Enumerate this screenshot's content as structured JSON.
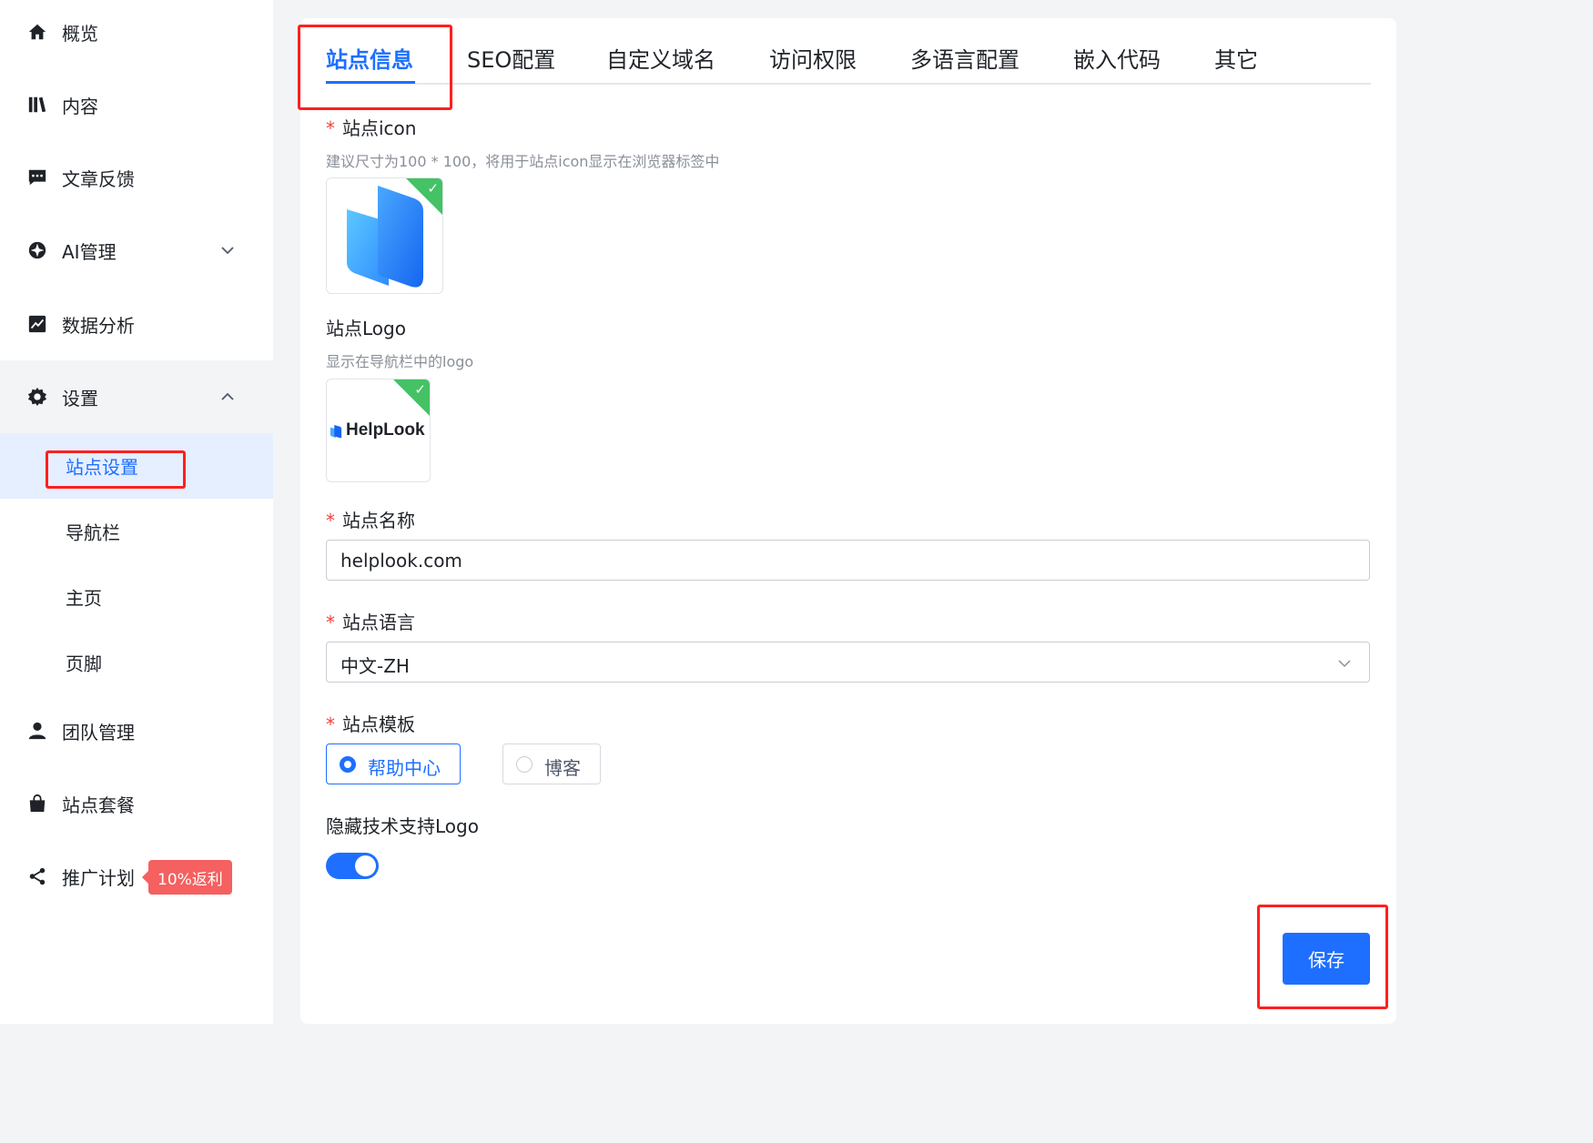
{
  "sidebar": {
    "items": [
      {
        "label": "概览",
        "icon": "home-icon"
      },
      {
        "label": "内容",
        "icon": "books-icon"
      },
      {
        "label": "文章反馈",
        "icon": "comment-icon"
      },
      {
        "label": "AI管理",
        "icon": "ai-icon"
      },
      {
        "label": "数据分析",
        "icon": "chart-icon"
      },
      {
        "label": "设置",
        "icon": "gear-icon"
      },
      {
        "label": "团队管理",
        "icon": "user-icon"
      },
      {
        "label": "站点套餐",
        "icon": "bag-icon"
      },
      {
        "label": "推广计划",
        "icon": "share-icon"
      }
    ],
    "settings_sub": [
      "站点设置",
      "导航栏",
      "主页",
      "页脚"
    ],
    "promo_badge": "10%返利"
  },
  "tabs": [
    "站点信息",
    "SEO配置",
    "自定义域名",
    "访问权限",
    "多语言配置",
    "嵌入代码",
    "其它"
  ],
  "form": {
    "icon_label": "站点icon",
    "icon_hint": "建议尺寸为100 * 100，将用于站点icon显示在浏览器标签中",
    "logo_label": "站点Logo",
    "logo_hint": "显示在导航栏中的logo",
    "logo_text": "HelpLook",
    "name_label": "站点名称",
    "name_value": "helplook.com",
    "lang_label": "站点语言",
    "lang_value": "中文-ZH",
    "template_label": "站点模板",
    "template_options": [
      "帮助中心",
      "博客"
    ],
    "template_selected": "帮助中心",
    "hide_logo_label": "隐藏技术支持Logo",
    "hide_logo_on": true,
    "save_label": "保存",
    "required_mark": "*"
  },
  "colors": {
    "accent": "#1e6fff",
    "highlight": "#ff1f1f",
    "badge": "#f56060",
    "check": "#44c265"
  }
}
